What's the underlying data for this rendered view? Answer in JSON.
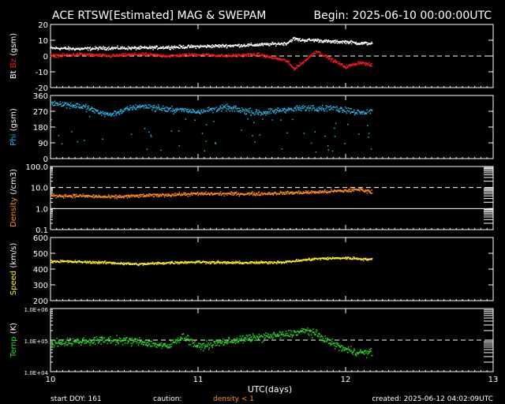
{
  "header": {
    "title": "ACE RTSW[Estimated] MAG & SWEPAM",
    "begin": "Begin: 2025-06-10 00:00:00UTC"
  },
  "footer": {
    "start_doy": "start DOY: 161",
    "caution": "caution:",
    "caution_note": "density < 1",
    "created": "created: 2025-06-12 04:02:09UTC"
  },
  "colors": {
    "background": "#000000",
    "axes": "#ffffff",
    "bt": "#ffffff",
    "bz": "#ff1a1a",
    "phi": "#22b8e8",
    "density": "#ff8c1a",
    "speed": "#ffee22",
    "temp": "#22dd22",
    "caution": "#ff8c1a"
  },
  "chart_data": [
    {
      "type": "scatter",
      "ylabel_parts": [
        {
          "text": "Bt",
          "color": "#ffffff"
        },
        {
          "text": "Bz",
          "color": "#ff1a1a"
        },
        {
          "text": "(gsm)",
          "color": "#ffffff"
        }
      ],
      "ylim": [
        -20,
        20
      ],
      "yticks": [
        "20",
        "10",
        "0",
        "-10",
        "-20"
      ],
      "xlim": [
        10,
        13
      ],
      "xticks": [
        "10",
        "11",
        "12",
        "13"
      ],
      "xlabel": "",
      "dashed_reference": 0,
      "series": [
        {
          "name": "Bt",
          "x": [
            10.0,
            10.2,
            10.4,
            10.6,
            10.8,
            11.0,
            11.2,
            11.4,
            11.6,
            11.65,
            11.7,
            11.8,
            11.9,
            12.0,
            12.1,
            12.18
          ],
          "values": [
            5,
            4.5,
            5,
            5,
            5.5,
            6,
            6.5,
            7,
            8,
            11,
            10,
            10,
            9,
            9,
            8,
            8
          ]
        },
        {
          "name": "Bz",
          "x": [
            10.0,
            10.2,
            10.4,
            10.6,
            10.8,
            11.0,
            11.2,
            11.4,
            11.6,
            11.65,
            11.7,
            11.8,
            11.9,
            12.0,
            12.1,
            12.18
          ],
          "values": [
            0,
            1,
            0,
            1,
            0,
            1,
            0,
            1,
            -3,
            -8,
            -5,
            3,
            -2,
            -7,
            -4,
            -6
          ]
        }
      ]
    },
    {
      "type": "scatter",
      "ylabel_parts": [
        {
          "text": "Phi",
          "color": "#22b8e8"
        },
        {
          "text": "(gsm)",
          "color": "#ffffff"
        }
      ],
      "ylim": [
        0,
        360
      ],
      "yticks": [
        "360",
        "270",
        "180",
        "90",
        "0"
      ],
      "xlim": [
        10,
        13
      ],
      "xticks": [
        "10",
        "11",
        "12",
        "13"
      ],
      "xlabel": "",
      "series": [
        {
          "name": "Phi",
          "x": [
            10.0,
            10.2,
            10.4,
            10.6,
            10.8,
            11.0,
            11.2,
            11.4,
            11.6,
            11.8,
            12.0,
            12.1,
            12.18
          ],
          "values": [
            320,
            300,
            250,
            300,
            280,
            270,
            290,
            260,
            280,
            290,
            280,
            260,
            270
          ]
        }
      ]
    },
    {
      "type": "scatter",
      "ylabel_parts": [
        {
          "text": "Density",
          "color": "#ff8c1a"
        },
        {
          "text": "(/cm3)",
          "color": "#ffffff"
        }
      ],
      "yscale": "log",
      "ylim": [
        0.1,
        100
      ],
      "yticks": [
        "100.0",
        "10.0",
        "1.0",
        "0.1"
      ],
      "xlim": [
        10,
        13
      ],
      "xticks": [
        "10",
        "11",
        "12",
        "13"
      ],
      "xlabel": "",
      "dashed_reference": 10,
      "series": [
        {
          "name": "Density",
          "x": [
            10.0,
            10.2,
            10.4,
            10.6,
            10.8,
            11.0,
            11.2,
            11.4,
            11.6,
            11.8,
            12.0,
            12.1,
            12.18
          ],
          "values": [
            4,
            4,
            3.5,
            4,
            4.5,
            5,
            5,
            5,
            5.5,
            6,
            7,
            8,
            6
          ]
        }
      ]
    },
    {
      "type": "scatter",
      "ylabel_parts": [
        {
          "text": "Speed",
          "color": "#ffee22"
        },
        {
          "text": "(km/s)",
          "color": "#ffffff"
        }
      ],
      "ylim": [
        200,
        600
      ],
      "yticks": [
        "600",
        "500",
        "400",
        "300",
        "200"
      ],
      "xlim": [
        10,
        13
      ],
      "xticks": [
        "10",
        "11",
        "12",
        "13"
      ],
      "xlabel": "",
      "series": [
        {
          "name": "Speed",
          "x": [
            10.0,
            10.2,
            10.4,
            10.6,
            10.8,
            11.0,
            11.2,
            11.4,
            11.6,
            11.8,
            12.0,
            12.1,
            12.18
          ],
          "values": [
            450,
            445,
            440,
            430,
            440,
            445,
            440,
            440,
            445,
            465,
            470,
            465,
            460
          ]
        }
      ]
    },
    {
      "type": "scatter",
      "ylabel_parts": [
        {
          "text": "Temp",
          "color": "#22dd22"
        },
        {
          "text": "(K)",
          "color": "#ffffff"
        }
      ],
      "yscale": "log",
      "ylim": [
        10000,
        1000000
      ],
      "yticks": [
        "1.0E+06",
        "1.0E+05",
        "1.0E+04"
      ],
      "xlim": [
        10,
        13
      ],
      "xticks": [
        "10",
        "11",
        "12",
        "13"
      ],
      "xlabel": "UTC(days)",
      "dashed_reference": 100000,
      "series": [
        {
          "name": "Temp",
          "x": [
            10.0,
            10.2,
            10.4,
            10.6,
            10.8,
            10.9,
            11.0,
            11.2,
            11.4,
            11.6,
            11.75,
            11.8,
            11.9,
            12.0,
            12.1,
            12.18
          ],
          "values": [
            80000,
            90000,
            100000,
            90000,
            60000,
            130000,
            60000,
            90000,
            120000,
            150000,
            200000,
            150000,
            80000,
            50000,
            40000,
            40000
          ]
        }
      ]
    }
  ]
}
